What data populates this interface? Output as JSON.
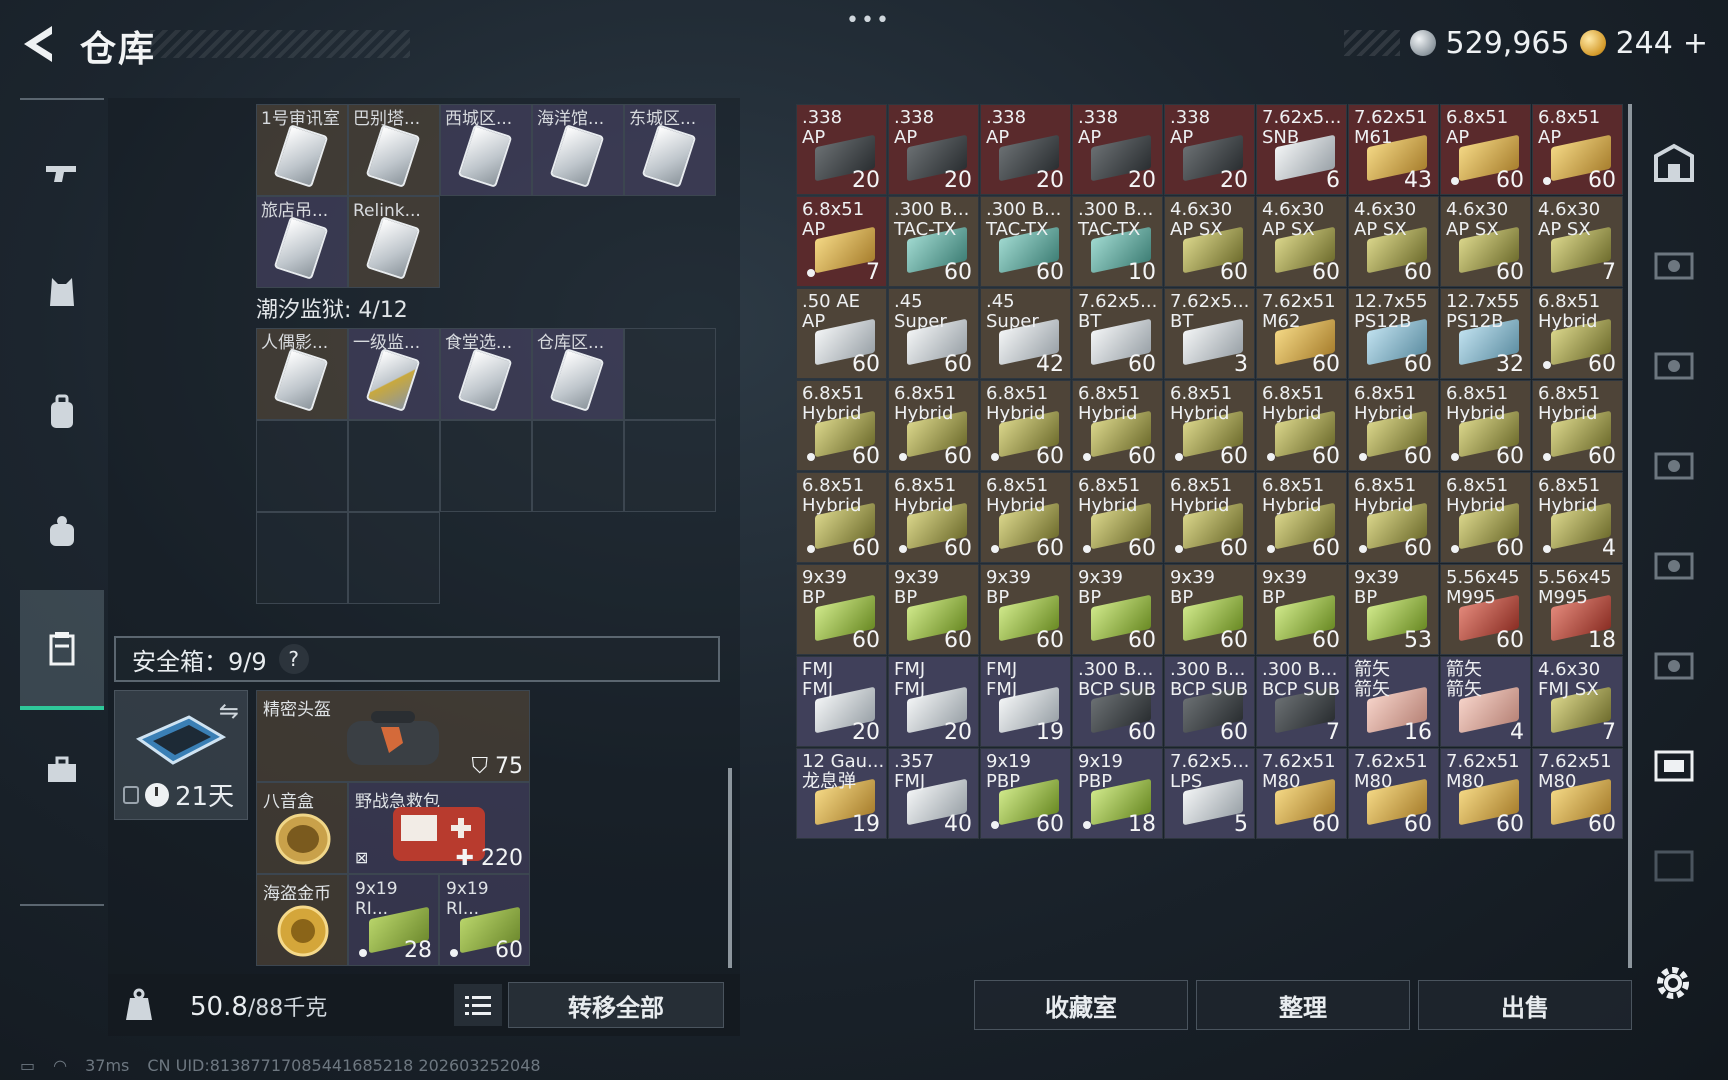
{
  "header": {
    "title": "仓库",
    "menu_dots": "•••",
    "silver_amount": "529,965",
    "gold_amount": "244",
    "gold_plus": "+"
  },
  "sidebar": {
    "items": [
      {
        "id": "weapons",
        "icon": "gun-icon"
      },
      {
        "id": "armor",
        "icon": "vest-icon"
      },
      {
        "id": "backpack",
        "icon": "backpack-icon"
      },
      {
        "id": "rig",
        "icon": "rig-icon"
      },
      {
        "id": "stash",
        "icon": "container-icon",
        "active": true
      },
      {
        "id": "case",
        "icon": "briefcase-icon"
      }
    ]
  },
  "keys_top": {
    "row1": [
      "1号审讯室",
      "巴别塔...",
      "西城区...",
      "海洋馆...",
      "东城区..."
    ],
    "row2": [
      "旅店吊...",
      "Relink..."
    ]
  },
  "prison": {
    "title": "潮汐监狱: 4/12",
    "items": [
      "人偶影...",
      "一级监...",
      "食堂选...",
      "仓库区..."
    ]
  },
  "safe": {
    "title": "安全箱：9/9",
    "help": "?",
    "days": "21天",
    "items": {
      "helmet_name": "精密头盔",
      "helmet_durability": "75",
      "compass_name": "八音盒",
      "medkit_name": "野战急救包",
      "medkit_value": "220",
      "coin_name": "海盗金币",
      "ammo1_name": "9x19\nRI...",
      "ammo1_count": "28",
      "ammo2_name": "9x19\nRI...",
      "ammo2_count": "60"
    }
  },
  "weight": {
    "current": "50.8",
    "capacity": "/88千克",
    "transfer_all": "转移全部"
  },
  "stash_grid": [
    [
      {
        "n": ".338\nAP",
        "c": "20",
        "t": "dark",
        "bg": "red"
      },
      {
        "n": ".338\nAP",
        "c": "20",
        "t": "dark",
        "bg": "red"
      },
      {
        "n": ".338\nAP",
        "c": "20",
        "t": "dark",
        "bg": "red"
      },
      {
        "n": ".338\nAP",
        "c": "20",
        "t": "dark",
        "bg": "red"
      },
      {
        "n": ".338\nAP",
        "c": "20",
        "t": "dark",
        "bg": "red"
      },
      {
        "n": "7.62x5...\nSNB",
        "c": "6",
        "t": "white",
        "bg": "red"
      },
      {
        "n": "7.62x51\nM61",
        "c": "43",
        "t": "tan",
        "bg": "red"
      },
      {
        "n": "6.8x51\nAP",
        "c": "60",
        "t": "tan",
        "bg": "red",
        "d": true
      },
      {
        "n": "6.8x51\nAP",
        "c": "60",
        "t": "tan",
        "bg": "red",
        "d": true
      }
    ],
    [
      {
        "n": "6.8x51\nAP",
        "c": "7",
        "t": "tan",
        "bg": "red",
        "d": true
      },
      {
        "n": ".300 B...\nTAC-TX",
        "c": "60",
        "t": "teal",
        "bg": "brown"
      },
      {
        "n": ".300 B...\nTAC-TX",
        "c": "60",
        "t": "teal",
        "bg": "brown"
      },
      {
        "n": ".300 B...\nTAC-TX",
        "c": "10",
        "t": "teal",
        "bg": "brown"
      },
      {
        "n": "4.6x30\nAP SX",
        "c": "60",
        "t": "olive",
        "bg": "brown"
      },
      {
        "n": "4.6x30\nAP SX",
        "c": "60",
        "t": "olive",
        "bg": "brown"
      },
      {
        "n": "4.6x30\nAP SX",
        "c": "60",
        "t": "olive",
        "bg": "brown"
      },
      {
        "n": "4.6x30\nAP SX",
        "c": "60",
        "t": "olive",
        "bg": "brown"
      },
      {
        "n": "4.6x30\nAP SX",
        "c": "7",
        "t": "olive",
        "bg": "brown"
      }
    ],
    [
      {
        "n": ".50 AE\nAP",
        "c": "60",
        "t": "white",
        "bg": "brown"
      },
      {
        "n": ".45\nSuper",
        "c": "60",
        "t": "white",
        "bg": "brown"
      },
      {
        "n": ".45\nSuper",
        "c": "42",
        "t": "white",
        "bg": "brown"
      },
      {
        "n": "7.62x5...\nBT",
        "c": "60",
        "t": "white",
        "bg": "brown"
      },
      {
        "n": "7.62x5...\nBT",
        "c": "3",
        "t": "white",
        "bg": "brown"
      },
      {
        "n": "7.62x51\nM62",
        "c": "60",
        "t": "tan",
        "bg": "brown"
      },
      {
        "n": "12.7x55\nPS12B",
        "c": "60",
        "t": "lightblue",
        "bg": "brown"
      },
      {
        "n": "12.7x55\nPS12B",
        "c": "32",
        "t": "lightblue",
        "bg": "brown"
      },
      {
        "n": "6.8x51\nHybrid",
        "c": "60",
        "t": "olive",
        "bg": "brown",
        "d": true
      }
    ],
    [
      {
        "n": "6.8x51\nHybrid",
        "c": "60",
        "t": "olive",
        "bg": "brown",
        "d": true
      },
      {
        "n": "6.8x51\nHybrid",
        "c": "60",
        "t": "olive",
        "bg": "brown",
        "d": true
      },
      {
        "n": "6.8x51\nHybrid",
        "c": "60",
        "t": "olive",
        "bg": "brown",
        "d": true
      },
      {
        "n": "6.8x51\nHybrid",
        "c": "60",
        "t": "olive",
        "bg": "brown",
        "d": true
      },
      {
        "n": "6.8x51\nHybrid",
        "c": "60",
        "t": "olive",
        "bg": "brown",
        "d": true
      },
      {
        "n": "6.8x51\nHybrid",
        "c": "60",
        "t": "olive",
        "bg": "brown",
        "d": true
      },
      {
        "n": "6.8x51\nHybrid",
        "c": "60",
        "t": "olive",
        "bg": "brown",
        "d": true
      },
      {
        "n": "6.8x51\nHybrid",
        "c": "60",
        "t": "olive",
        "bg": "brown",
        "d": true
      },
      {
        "n": "6.8x51\nHybrid",
        "c": "60",
        "t": "olive",
        "bg": "brown",
        "d": true
      }
    ],
    [
      {
        "n": "6.8x51\nHybrid",
        "c": "60",
        "t": "olive",
        "bg": "brown",
        "d": true
      },
      {
        "n": "6.8x51\nHybrid",
        "c": "60",
        "t": "olive",
        "bg": "brown",
        "d": true
      },
      {
        "n": "6.8x51\nHybrid",
        "c": "60",
        "t": "olive",
        "bg": "brown",
        "d": true
      },
      {
        "n": "6.8x51\nHybrid",
        "c": "60",
        "t": "olive",
        "bg": "brown",
        "d": true
      },
      {
        "n": "6.8x51\nHybrid",
        "c": "60",
        "t": "olive",
        "bg": "brown",
        "d": true
      },
      {
        "n": "6.8x51\nHybrid",
        "c": "60",
        "t": "olive",
        "bg": "brown",
        "d": true
      },
      {
        "n": "6.8x51\nHybrid",
        "c": "60",
        "t": "olive",
        "bg": "brown",
        "d": true
      },
      {
        "n": "6.8x51\nHybrid",
        "c": "60",
        "t": "olive",
        "bg": "brown",
        "d": true
      },
      {
        "n": "6.8x51\nHybrid",
        "c": "4",
        "t": "olive",
        "bg": "brown",
        "d": true
      }
    ],
    [
      {
        "n": "9x39\nBP",
        "c": "60",
        "t": "green",
        "bg": "brown"
      },
      {
        "n": "9x39\nBP",
        "c": "60",
        "t": "green",
        "bg": "brown"
      },
      {
        "n": "9x39\nBP",
        "c": "60",
        "t": "green",
        "bg": "brown"
      },
      {
        "n": "9x39\nBP",
        "c": "60",
        "t": "green",
        "bg": "brown"
      },
      {
        "n": "9x39\nBP",
        "c": "60",
        "t": "green",
        "bg": "brown"
      },
      {
        "n": "9x39\nBP",
        "c": "60",
        "t": "green",
        "bg": "brown"
      },
      {
        "n": "9x39\nBP",
        "c": "53",
        "t": "green",
        "bg": "brown"
      },
      {
        "n": "5.56x45\nM995",
        "c": "60",
        "t": "redbox",
        "bg": "brown"
      },
      {
        "n": "5.56x45\nM995",
        "c": "18",
        "t": "redbox",
        "bg": "brown"
      }
    ],
    [
      {
        "n": "FMJ\nFMJ",
        "c": "20",
        "t": "white",
        "bg": "purple"
      },
      {
        "n": "FMJ\nFMJ",
        "c": "20",
        "t": "white",
        "bg": "purple"
      },
      {
        "n": "FMJ\nFMJ",
        "c": "19",
        "t": "white",
        "bg": "purple"
      },
      {
        "n": ".300 B...\nBCP SUB",
        "c": "60",
        "t": "dark",
        "bg": "purple"
      },
      {
        "n": ".300 B...\nBCP SUB",
        "c": "60",
        "t": "dark",
        "bg": "purple"
      },
      {
        "n": ".300 B...\nBCP SUB",
        "c": "7",
        "t": "dark",
        "bg": "purple"
      },
      {
        "n": "箭矢\n箭矢",
        "c": "16",
        "t": "pink",
        "bg": "purple"
      },
      {
        "n": "箭矢\n箭矢",
        "c": "4",
        "t": "pink",
        "bg": "purple"
      },
      {
        "n": "4.6x30\nFMJ SX",
        "c": "7",
        "t": "olive",
        "bg": "purple"
      }
    ],
    [
      {
        "n": "12 Gau...\n龙息弹",
        "c": "19",
        "t": "tan",
        "bg": "purple"
      },
      {
        "n": ".357\nFMJ",
        "c": "40",
        "t": "white",
        "bg": "purple"
      },
      {
        "n": "9x19\nPBP",
        "c": "60",
        "t": "green",
        "bg": "purple",
        "d": true
      },
      {
        "n": "9x19\nPBP",
        "c": "18",
        "t": "green",
        "bg": "purple",
        "d": true
      },
      {
        "n": "7.62x5...\nLPS",
        "c": "5",
        "t": "white",
        "bg": "purple"
      },
      {
        "n": "7.62x51\nM80",
        "c": "60",
        "t": "tan",
        "bg": "purple"
      },
      {
        "n": "7.62x51\nM80",
        "c": "60",
        "t": "tan",
        "bg": "purple"
      },
      {
        "n": "7.62x51\nM80",
        "c": "60",
        "t": "tan",
        "bg": "purple"
      },
      {
        "n": "7.62x51\nM80",
        "c": "60",
        "t": "tan",
        "bg": "purple"
      }
    ]
  ],
  "colors": {
    "cell_red": "#5a2a2c",
    "cell_brown": "#4e4438",
    "cell_purple": "#40405a",
    "accent_green": "#2fc89a"
  },
  "actions": {
    "collection": "收藏室",
    "organize": "整理",
    "sell": "出售"
  },
  "status": {
    "ping": "37ms",
    "uid": "CN UID:813877170854416852​18 202603252048"
  }
}
